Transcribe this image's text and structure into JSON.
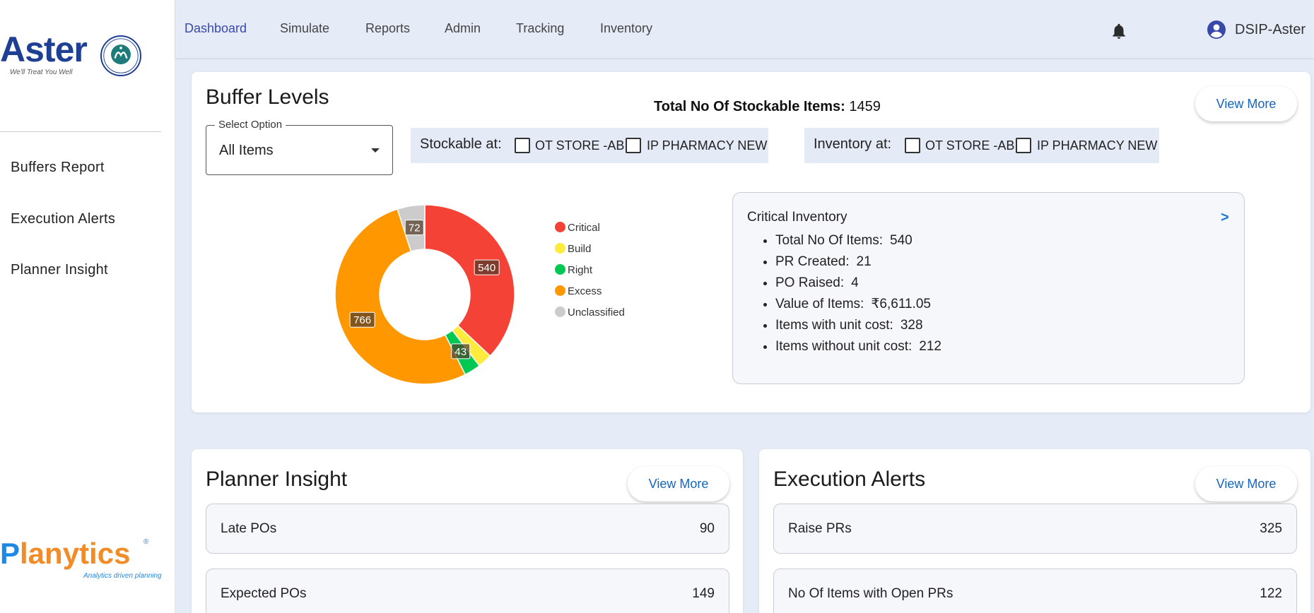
{
  "sidebar": {
    "brand_logo": {
      "name": "Aster",
      "tagline": "We'll Treat You Well"
    },
    "items": [
      {
        "label": "Buffers Report"
      },
      {
        "label": "Execution Alerts"
      },
      {
        "label": "Planner Insight"
      }
    ],
    "footer_logo": {
      "name_p": "P",
      "name_rest": "lanytics",
      "registered": "®",
      "tagline": "Analytics driven planning"
    }
  },
  "topnav": {
    "links": [
      {
        "label": "Dashboard",
        "active": true
      },
      {
        "label": "Simulate"
      },
      {
        "label": "Reports"
      },
      {
        "label": "Admin"
      },
      {
        "label": "Tracking"
      },
      {
        "label": "Inventory"
      }
    ],
    "notifications_icon": "bell-icon",
    "user": {
      "icon": "account-circle-icon",
      "name": "DSIP-Aster"
    }
  },
  "buffer_levels": {
    "title": "Buffer Levels",
    "total_label": "Total No Of Stockable Items:",
    "total_value": "1459",
    "view_more": "View More",
    "select": {
      "legend": "Select Option",
      "value": "All Items"
    },
    "stockable": {
      "label": "Stockable at:",
      "options": [
        "OT STORE -AB",
        "IP PHARMACY NEW"
      ]
    },
    "inventory": {
      "label": "Inventory at:",
      "options": [
        "OT STORE -AB",
        "IP PHARMACY NEW"
      ]
    }
  },
  "chart_data": {
    "type": "pie",
    "variant": "donut",
    "categories": [
      "Critical",
      "Build",
      "Right",
      "Excess",
      "Unclassified"
    ],
    "values": [
      540,
      38,
      43,
      766,
      72
    ],
    "data_labels": [
      "540",
      "",
      "43",
      "766",
      "72"
    ],
    "colors": [
      "#f44336",
      "#ffeb3b",
      "#00c853",
      "#ff9800",
      "#cccccc"
    ],
    "legend_position": "right"
  },
  "critical_inventory": {
    "title": "Critical Inventory",
    "arrow": ">",
    "items": [
      {
        "label": "Total No Of Items:",
        "value": "540"
      },
      {
        "label": "PR Created:",
        "value": "21"
      },
      {
        "label": "PO Raised:",
        "value": "4"
      },
      {
        "label": "Value of Items:",
        "value": "₹6,611.05"
      },
      {
        "label": "Items with unit cost:",
        "value": "328"
      },
      {
        "label": "Items without unit cost:",
        "value": "212"
      }
    ]
  },
  "planner_insight": {
    "title": "Planner Insight",
    "view_more": "View More",
    "rows": [
      {
        "label": "Late POs",
        "value": "90"
      },
      {
        "label": "Expected POs",
        "value": "149"
      }
    ]
  },
  "execution_alerts": {
    "title": "Execution Alerts",
    "view_more": "View More",
    "rows": [
      {
        "label": "Raise PRs",
        "value": "325"
      },
      {
        "label": "No Of Items with Open PRs",
        "value": "122"
      }
    ]
  }
}
